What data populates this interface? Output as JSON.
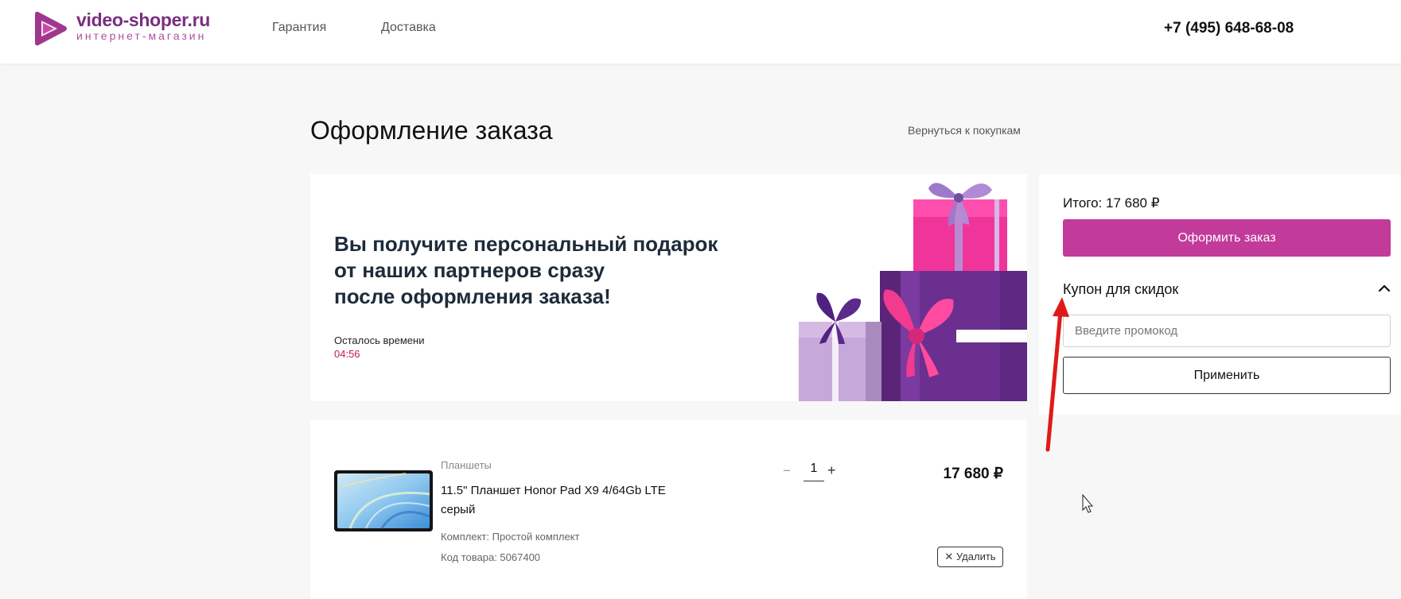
{
  "header": {
    "logo_name": "video-shoper.ru",
    "logo_sub": "интернет-магазин",
    "nav": [
      {
        "label": "Гарантия"
      },
      {
        "label": "Доставка"
      }
    ],
    "phone": "+7 (495) 648-68-08"
  },
  "page": {
    "title": "Оформление заказа",
    "back_link": "Вернуться к покупкам"
  },
  "banner": {
    "headline_lines": [
      "Вы получите персональный подарок",
      "от наших партнеров сразу",
      "после оформления заказа!"
    ],
    "timer_label": "Осталось времени",
    "timer_value": "04:56"
  },
  "sidebar": {
    "total": "Итого: 17 680 ₽",
    "checkout_label": "Оформить заказ",
    "coupon_title": "Купон для скидок",
    "promo_placeholder": "Введите промокод",
    "apply_label": "Применить"
  },
  "product": {
    "category": "Планшеты",
    "name": "11.5\" Планшет Honor Pad X9 4/64Gb LTE серый",
    "kit": "Комплект: Простой комплект",
    "code": "Код товара: 5067400",
    "quantity": "1",
    "qty_minus": "−",
    "qty_plus": "+",
    "price": "17 680 ₽",
    "delete_label": "✕ Удалить"
  },
  "colors": {
    "brand": "#7a2e7e",
    "checkout_button": "#c23a9a",
    "timer": "#c2185b",
    "annotation_arrow": "#e01a1a"
  },
  "icons": [
    "logo-play-icon",
    "chevron-up-icon",
    "close-icon",
    "mouse-cursor-icon",
    "annotation-arrow-icon"
  ]
}
